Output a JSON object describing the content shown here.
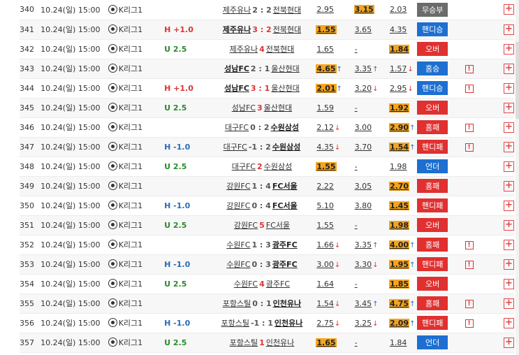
{
  "rows": [
    {
      "no": "340",
      "date": "10.24(일) 15:00",
      "league": "K리그1",
      "hc": "",
      "hc_type": "",
      "home": "제주유나",
      "score": "2 : 2",
      "score_type": "normal",
      "away": "전북현대",
      "winner": "",
      "o1": "2.95",
      "o1_hi": false,
      "o1_arr": "",
      "o2": "3.15",
      "o2_hi": true,
      "o2_arr": "",
      "o3": "2.03",
      "o3_hi": false,
      "o3_arr": "",
      "result": "무승부",
      "result_color": "gray",
      "flag": false
    },
    {
      "no": "341",
      "date": "10.24(일) 15:00",
      "league": "K리그1",
      "hc": "H +1.0",
      "hc_type": "h",
      "home": "제주유나",
      "score": "3 : 2",
      "score_type": "red",
      "away": "전북현대",
      "winner": "home",
      "o1": "1.55",
      "o1_hi": true,
      "o1_arr": "",
      "o2": "3.65",
      "o2_hi": false,
      "o2_arr": "",
      "o3": "4.35",
      "o3_hi": false,
      "o3_arr": "",
      "result": "핸디승",
      "result_color": "blue",
      "flag": false
    },
    {
      "no": "342",
      "date": "10.24(일) 15:00",
      "league": "K리그1",
      "hc": "U 2.5",
      "hc_type": "u",
      "home": "제주유나",
      "score": "4",
      "score_type": "red",
      "away": "전북현대",
      "winner": "",
      "o1": "1.65",
      "o1_hi": false,
      "o1_arr": "",
      "o2": "-",
      "o2_hi": false,
      "o2_arr": "",
      "o3": "1.84",
      "o3_hi": true,
      "o3_arr": "",
      "result": "오버",
      "result_color": "red",
      "flag": false
    },
    {
      "no": "343",
      "date": "10.24(일) 15:00",
      "league": "K리그1",
      "hc": "",
      "hc_type": "",
      "home": "성남FC",
      "score": "2 : 1",
      "score_type": "red2",
      "away": "울산현대",
      "winner": "home",
      "o1": "4.65",
      "o1_hi": true,
      "o1_arr": "up",
      "o2": "3.35",
      "o2_hi": false,
      "o2_arr": "up",
      "o3": "1.57",
      "o3_hi": false,
      "o3_arr": "dn",
      "result": "홈승",
      "result_color": "blue",
      "flag": true
    },
    {
      "no": "344",
      "date": "10.24(일) 15:00",
      "league": "K리그1",
      "hc": "H +1.0",
      "hc_type": "h",
      "home": "성남FC",
      "score": "3 : 1",
      "score_type": "red",
      "away": "울산현대",
      "winner": "home",
      "o1": "2.01",
      "o1_hi": true,
      "o1_arr": "up",
      "o2": "3.20",
      "o2_hi": false,
      "o2_arr": "dn",
      "o3": "2.95",
      "o3_hi": false,
      "o3_arr": "dn",
      "result": "핸디승",
      "result_color": "blue",
      "flag": true
    },
    {
      "no": "345",
      "date": "10.24(일) 15:00",
      "league": "K리그1",
      "hc": "U 2.5",
      "hc_type": "u",
      "home": "성남FC",
      "score": "3",
      "score_type": "red",
      "away": "울산현대",
      "winner": "",
      "o1": "1.59",
      "o1_hi": false,
      "o1_arr": "",
      "o2": "-",
      "o2_hi": false,
      "o2_arr": "",
      "o3": "1.92",
      "o3_hi": true,
      "o3_arr": "",
      "result": "오버",
      "result_color": "red",
      "flag": false
    },
    {
      "no": "346",
      "date": "10.24(일) 15:00",
      "league": "K리그1",
      "hc": "",
      "hc_type": "",
      "home": "대구FC",
      "score": "0 : 2",
      "score_type": "red2",
      "away": "수원삼성",
      "winner": "away",
      "o1": "2.12",
      "o1_hi": false,
      "o1_arr": "dn",
      "o2": "3.00",
      "o2_hi": false,
      "o2_arr": "",
      "o3": "2.90",
      "o3_hi": true,
      "o3_arr": "up",
      "result": "홈패",
      "result_color": "red",
      "flag": true
    },
    {
      "no": "347",
      "date": "10.24(일) 15:00",
      "league": "K리그1",
      "hc": "H -1.0",
      "hc_type": "hm",
      "home": "대구FC",
      "score": "-1 : 2",
      "score_type": "red2",
      "away": "수원삼성",
      "winner": "away",
      "o1": "4.35",
      "o1_hi": false,
      "o1_arr": "dn",
      "o2": "3.70",
      "o2_hi": false,
      "o2_arr": "",
      "o3": "1.54",
      "o3_hi": true,
      "o3_arr": "up",
      "result": "핸디패",
      "result_color": "red",
      "flag": true
    },
    {
      "no": "348",
      "date": "10.24(일) 15:00",
      "league": "K리그1",
      "hc": "U 2.5",
      "hc_type": "u",
      "home": "대구FC",
      "score": "2",
      "score_type": "red",
      "away": "수원삼성",
      "winner": "",
      "o1": "1.55",
      "o1_hi": true,
      "o1_arr": "",
      "o2": "-",
      "o2_hi": false,
      "o2_arr": "",
      "o3": "1.98",
      "o3_hi": false,
      "o3_arr": "",
      "result": "언더",
      "result_color": "blue",
      "flag": false
    },
    {
      "no": "349",
      "date": "10.24(일) 15:00",
      "league": "K리그1",
      "hc": "",
      "hc_type": "",
      "home": "강원FC",
      "score": "1 : 4",
      "score_type": "red2",
      "away": "FC서울",
      "winner": "away",
      "o1": "2.22",
      "o1_hi": false,
      "o1_arr": "",
      "o2": "3.05",
      "o2_hi": false,
      "o2_arr": "",
      "o3": "2.70",
      "o3_hi": true,
      "o3_arr": "",
      "result": "홈패",
      "result_color": "red",
      "flag": false
    },
    {
      "no": "350",
      "date": "10.24(일) 15:00",
      "league": "K리그1",
      "hc": "H -1.0",
      "hc_type": "hm",
      "home": "강원FC",
      "score": "0 : 4",
      "score_type": "red2",
      "away": "FC서울",
      "winner": "away",
      "o1": "5.10",
      "o1_hi": false,
      "o1_arr": "",
      "o2": "3.80",
      "o2_hi": false,
      "o2_arr": "",
      "o3": "1.45",
      "o3_hi": true,
      "o3_arr": "",
      "result": "핸디패",
      "result_color": "red",
      "flag": false
    },
    {
      "no": "351",
      "date": "10.24(일) 15:00",
      "league": "K리그1",
      "hc": "U 2.5",
      "hc_type": "u",
      "home": "강원FC",
      "score": "5",
      "score_type": "red",
      "away": "FC서울",
      "winner": "",
      "o1": "1.55",
      "o1_hi": false,
      "o1_arr": "",
      "o2": "-",
      "o2_hi": false,
      "o2_arr": "",
      "o3": "1.98",
      "o3_hi": true,
      "o3_arr": "",
      "result": "오버",
      "result_color": "red",
      "flag": false
    },
    {
      "no": "352",
      "date": "10.24(일) 15:00",
      "league": "K리그1",
      "hc": "",
      "hc_type": "",
      "home": "수원FC",
      "score": "1 : 3",
      "score_type": "red2",
      "away": "광주FC",
      "winner": "away",
      "o1": "1.66",
      "o1_hi": false,
      "o1_arr": "dn",
      "o2": "3.35",
      "o2_hi": false,
      "o2_arr": "up",
      "o3": "4.00",
      "o3_hi": true,
      "o3_arr": "up",
      "result": "홈패",
      "result_color": "red",
      "flag": true
    },
    {
      "no": "353",
      "date": "10.24(일) 15:00",
      "league": "K리그1",
      "hc": "H -1.0",
      "hc_type": "hm",
      "home": "수원FC",
      "score": "0 : 3",
      "score_type": "red2",
      "away": "광주FC",
      "winner": "away",
      "o1": "3.00",
      "o1_hi": false,
      "o1_arr": "dn",
      "o2": "3.30",
      "o2_hi": false,
      "o2_arr": "dn",
      "o3": "1.95",
      "o3_hi": true,
      "o3_arr": "up",
      "result": "핸디패",
      "result_color": "red",
      "flag": true
    },
    {
      "no": "354",
      "date": "10.24(일) 15:00",
      "league": "K리그1",
      "hc": "U 2.5",
      "hc_type": "u",
      "home": "수원FC",
      "score": "4",
      "score_type": "red",
      "away": "광주FC",
      "winner": "",
      "o1": "1.64",
      "o1_hi": false,
      "o1_arr": "",
      "o2": "-",
      "o2_hi": false,
      "o2_arr": "",
      "o3": "1.85",
      "o3_hi": true,
      "o3_arr": "",
      "result": "오버",
      "result_color": "red",
      "flag": false
    },
    {
      "no": "355",
      "date": "10.24(일) 15:00",
      "league": "K리그1",
      "hc": "",
      "hc_type": "",
      "home": "포항스틸",
      "score": "0 : 1",
      "score_type": "red2",
      "away": "인천유나",
      "winner": "away",
      "o1": "1.54",
      "o1_hi": false,
      "o1_arr": "dn",
      "o2": "3.45",
      "o2_hi": false,
      "o2_arr": "up",
      "o3": "4.75",
      "o3_hi": true,
      "o3_arr": "up",
      "result": "홈패",
      "result_color": "red",
      "flag": true
    },
    {
      "no": "356",
      "date": "10.24(일) 15:00",
      "league": "K리그1",
      "hc": "H -1.0",
      "hc_type": "hm",
      "home": "포항스틸",
      "score": "-1 : 1",
      "score_type": "red2",
      "away": "인천유나",
      "winner": "away",
      "o1": "2.75",
      "o1_hi": false,
      "o1_arr": "dn",
      "o2": "3.25",
      "o2_hi": false,
      "o2_arr": "dn",
      "o3": "2.09",
      "o3_hi": true,
      "o3_arr": "up",
      "result": "핸디패",
      "result_color": "red",
      "flag": true
    },
    {
      "no": "357",
      "date": "10.24(일) 15:00",
      "league": "K리그1",
      "hc": "U 2.5",
      "hc_type": "u",
      "home": "포항스틸",
      "score": "1",
      "score_type": "red",
      "away": "인천유나",
      "winner": "",
      "o1": "1.65",
      "o1_hi": true,
      "o1_arr": "",
      "o2": "-",
      "o2_hi": false,
      "o2_arr": "",
      "o3": "1.84",
      "o3_hi": false,
      "o3_arr": "",
      "result": "언더",
      "result_color": "blue",
      "flag": false
    }
  ],
  "icons": {
    "league": "soccer-ball-icon",
    "flag": "alert-flag-icon",
    "plus": "plus-icon",
    "arrow_up": "↑",
    "arrow_down": "↓",
    "flag_glyph": "!",
    "plus_glyph": "+"
  },
  "colors": {
    "highlight": "#f4a51f",
    "blue_badge": "#1d6fd1",
    "red_badge": "#e03030",
    "gray_badge": "#6b6b6b",
    "handicap_home": "#d33",
    "handicap_minus": "#2a6bb5",
    "under_over": "#2a8a2a"
  }
}
